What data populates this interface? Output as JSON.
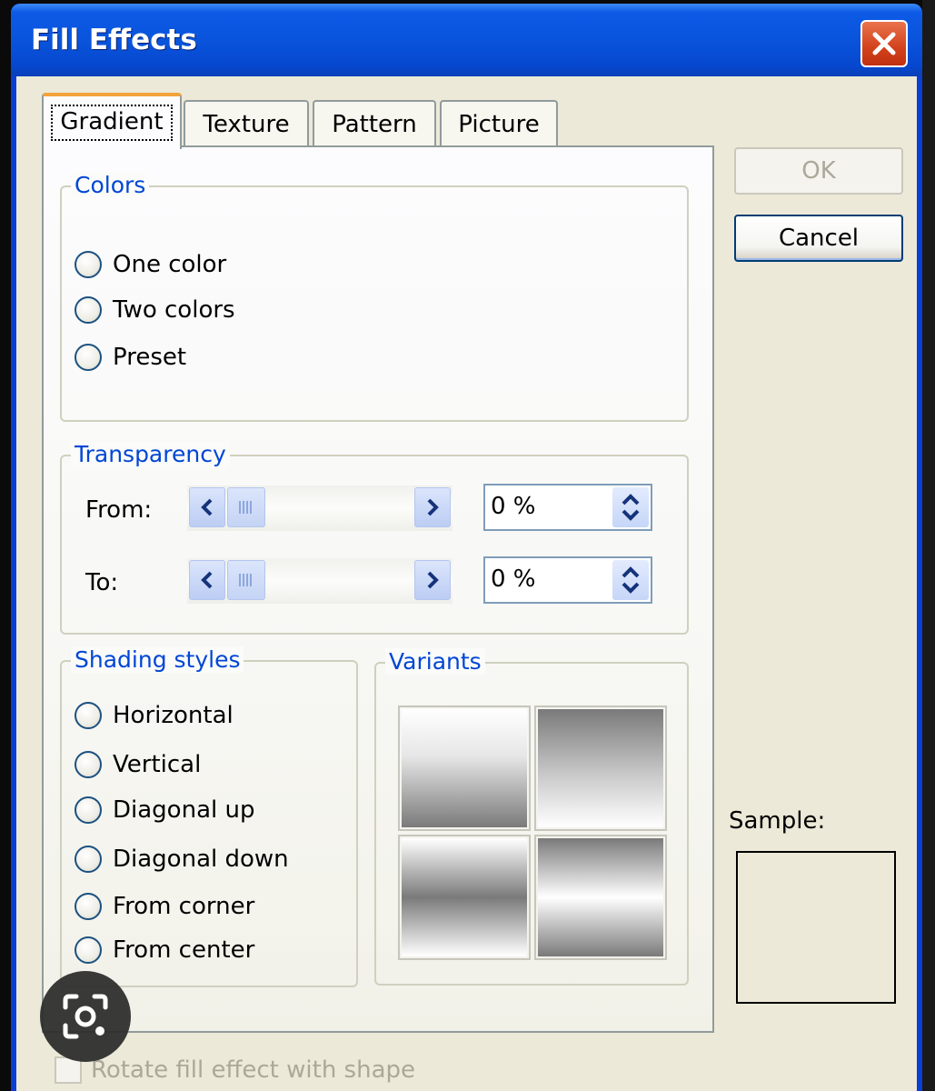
{
  "window": {
    "title": "Fill Effects"
  },
  "tabs": [
    {
      "label": "Gradient",
      "active": true
    },
    {
      "label": "Texture",
      "active": false
    },
    {
      "label": "Pattern",
      "active": false
    },
    {
      "label": "Picture",
      "active": false
    }
  ],
  "colors_group": {
    "label": "Colors",
    "options": [
      "One color",
      "Two colors",
      "Preset"
    ]
  },
  "transparency_group": {
    "label": "Transparency",
    "from_label": "From:",
    "from_value": "0 %",
    "to_label": "To:",
    "to_value": "0 %"
  },
  "shading_group": {
    "label": "Shading styles",
    "options": [
      "Horizontal",
      "Vertical",
      "Diagonal up",
      "Diagonal down",
      "From corner",
      "From center"
    ]
  },
  "variants_group": {
    "label": "Variants"
  },
  "buttons": {
    "ok": "OK",
    "cancel": "Cancel"
  },
  "sample": {
    "label": "Sample:"
  },
  "rotate_checkbox": {
    "label": "Rotate fill effect with shape",
    "checked": false
  },
  "colors": {
    "title_bar": "#0a54dc",
    "group_label": "#0046d5",
    "close_button": "#d2421c",
    "dialog_face": "#ece9d8"
  },
  "icons": {
    "close": "close-icon",
    "scroll_left": "chevron-left-icon",
    "scroll_right": "chevron-right-icon",
    "spin": "spin-arrows-icon",
    "lens": "lens-search-icon"
  }
}
